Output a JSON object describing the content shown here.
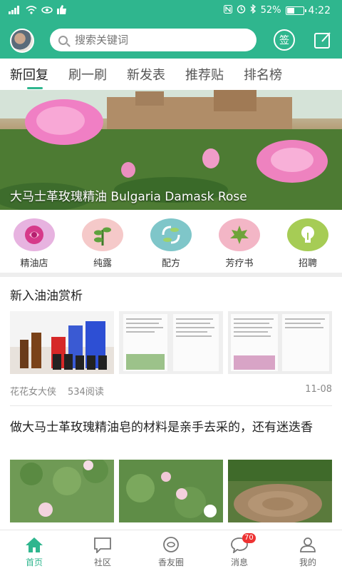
{
  "status_bar": {
    "battery": "52%",
    "time": "4:22",
    "battery_level": 0.52
  },
  "header": {
    "search_placeholder": "搜索关键词",
    "sign_label": "签"
  },
  "tabs": [
    {
      "label": "新回复"
    },
    {
      "label": "刷一刷"
    },
    {
      "label": "新发表"
    },
    {
      "label": "推荐贴"
    },
    {
      "label": "排名榜"
    }
  ],
  "banner": {
    "caption": "大马士革玫瑰精油 Bulgaria Damask Rose"
  },
  "categories": [
    {
      "label": "精油店",
      "icon": "rose-icon",
      "color": "#e7b3e0"
    },
    {
      "label": "纯露",
      "icon": "sprout-icon",
      "color": "#f5c9c9"
    },
    {
      "label": "配方",
      "icon": "leaf-cycle-icon",
      "color": "#7fc6c9"
    },
    {
      "label": "芳疗书",
      "icon": "maple-leaf-icon",
      "color": "#f3b6c6"
    },
    {
      "label": "招聘",
      "icon": "lightbulb-icon",
      "color": "#a6cc55"
    }
  ],
  "posts": [
    {
      "title": "新入油油赏析",
      "author": "花花女大侠",
      "reads": "534阅读",
      "date": "11-08"
    },
    {
      "title": "做大马士革玫瑰精油皂的材料是亲手去采的，还有迷迭香"
    }
  ],
  "bottom_nav": [
    {
      "label": "首页"
    },
    {
      "label": "社区"
    },
    {
      "label": "香友圈"
    },
    {
      "label": "消息",
      "badge": "70"
    },
    {
      "label": "我的"
    }
  ],
  "colors": {
    "accent": "#2fb68e"
  }
}
